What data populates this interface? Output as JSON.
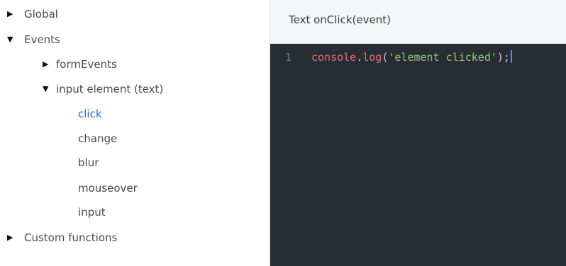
{
  "tree": {
    "global": {
      "label": "Global",
      "arrow": "▶"
    },
    "events": {
      "label": "Events",
      "arrow": "▼",
      "form_events": {
        "label": "formEvents",
        "arrow": "▶"
      },
      "input_element": {
        "label": "input element (text)",
        "arrow": "▼",
        "items": [
          "click",
          "change",
          "blur",
          "mouseover",
          "input"
        ]
      }
    },
    "custom_functions": {
      "label": "Custom functions",
      "arrow": "▶"
    }
  },
  "editor": {
    "title": "Text onClick(event)",
    "line_number": "1",
    "code": {
      "ident1": "console",
      "dot": ".",
      "ident2": "log",
      "open": "(",
      "string": "'element clicked'",
      "close": ");"
    }
  },
  "colors": {
    "active_item": "#2f6bd6",
    "editor_bg": "#282c34",
    "header_bg": "#f5f6f7",
    "code_ident": "#e06c75",
    "code_string": "#98c379"
  },
  "icons": {
    "expanded": "caret-down-icon",
    "collapsed": "caret-right-icon"
  }
}
